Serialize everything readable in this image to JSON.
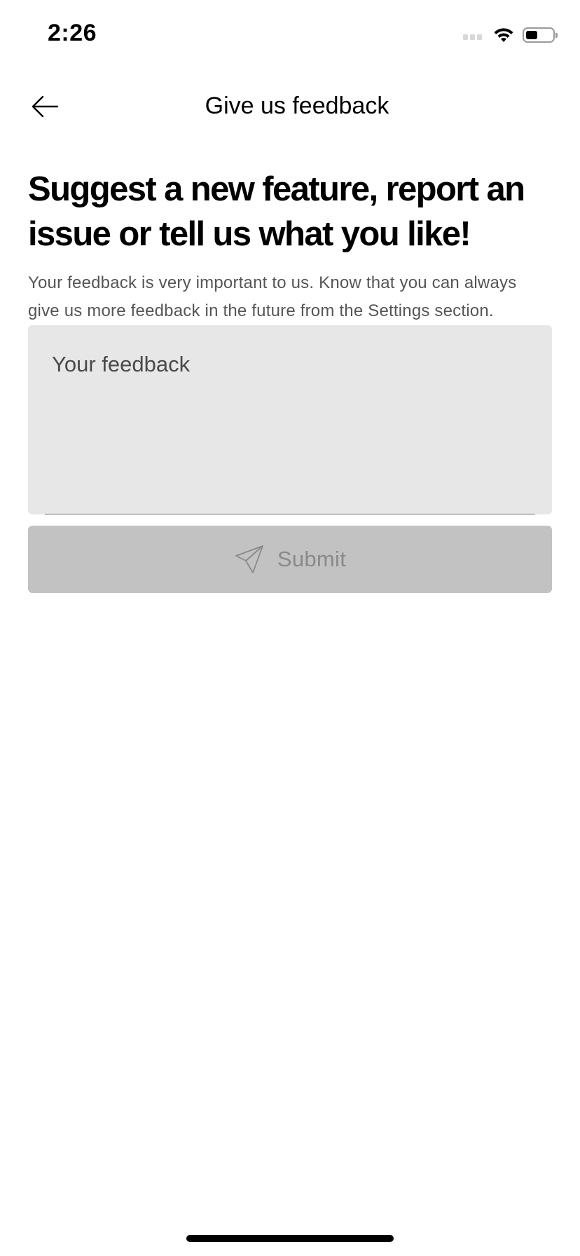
{
  "status_bar": {
    "time": "2:26",
    "signal_icon": "cellular-signal-icon",
    "wifi_icon": "wifi-icon",
    "battery_icon": "battery-icon",
    "battery_level": 0.45
  },
  "nav": {
    "back_icon": "arrow-left-icon",
    "title": "Give us feedback"
  },
  "main": {
    "headline": "Suggest a new feature, report an issue or tell us what you like!",
    "description": "Your feedback is very important to us. Know that you can always give us more feedback in the future from the Settings section.",
    "feedback_field": {
      "placeholder": "Your feedback",
      "value": ""
    },
    "submit": {
      "label": "Submit",
      "icon": "send-icon",
      "disabled": true
    }
  },
  "colors": {
    "input_background": "#e7e7e7",
    "button_disabled_background": "#c2c2c2",
    "button_disabled_text": "#8a8a8a"
  }
}
